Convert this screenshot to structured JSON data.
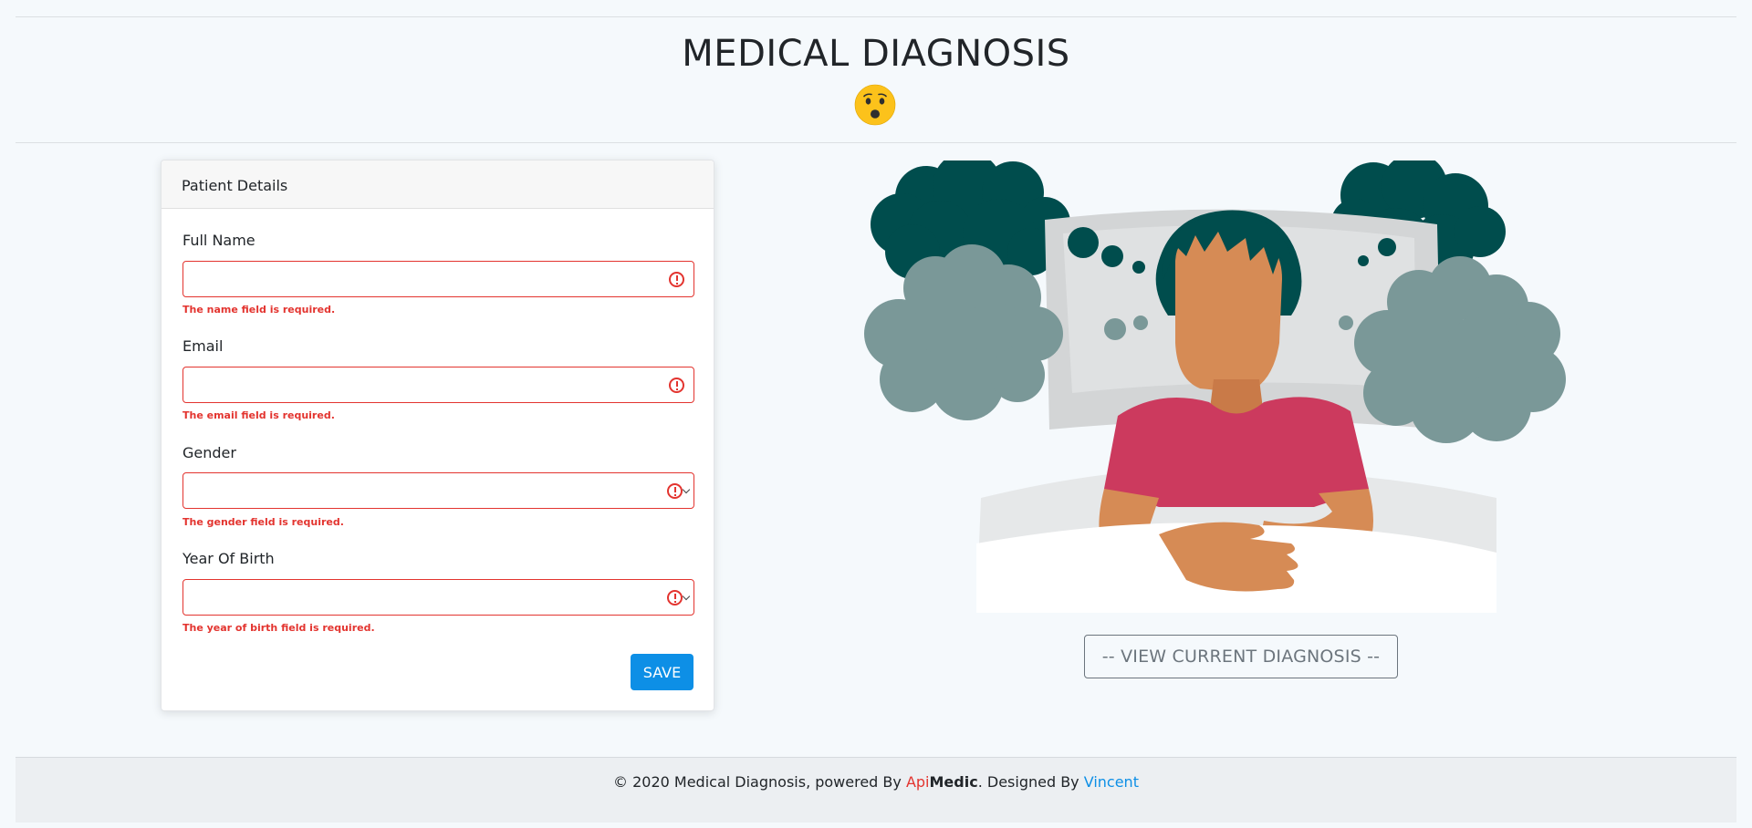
{
  "header": {
    "title": "MEDICAL DIAGNOSIS",
    "emoji_icon": "frowning-face-icon"
  },
  "form": {
    "card_title": "Patient Details",
    "fields": [
      {
        "label": "Full Name",
        "value": "",
        "error": "The name field is required.",
        "type": "text"
      },
      {
        "label": "Email",
        "value": "",
        "error": "The email field is required.",
        "type": "email"
      },
      {
        "label": "Gender",
        "value": "",
        "error": "The gender field is required.",
        "type": "select"
      },
      {
        "label": "Year Of Birth",
        "value": "",
        "error": "The year of birth field is required.",
        "type": "select"
      }
    ],
    "save_label": "SAVE"
  },
  "illustration": {
    "icon": "sick-person-in-bed-illustration"
  },
  "view_button_label": "-- VIEW CURRENT DIAGNOSIS --",
  "footer": {
    "prefix": "© 2020 Medical Diagnosis, powered By ",
    "brand_part1": "Api",
    "brand_part2": "Medic",
    "middle": ". Designed By ",
    "designer": "Vincent"
  },
  "colors": {
    "error": "#e3342f",
    "primary": "#0d8fe6",
    "dark_teal": "#004d4d",
    "gray_teal": "#7a9898",
    "skin": "#d68b55",
    "shirt": "#cc3a5e"
  }
}
